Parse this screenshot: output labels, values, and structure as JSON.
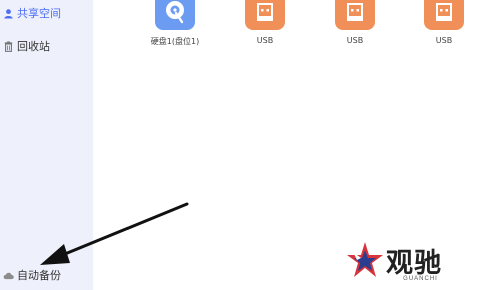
{
  "sidebar": {
    "items": [
      {
        "label": "共享空间",
        "icon": "user-share-icon",
        "active": true
      },
      {
        "label": "回收站",
        "icon": "trash-icon",
        "active": false
      },
      {
        "label": "自动备份",
        "icon": "cloud-icon",
        "active": false
      }
    ]
  },
  "drives": [
    {
      "label": "硬盘1(盘位1)",
      "icon": "hard-disk-icon",
      "color": "#6c9cf2"
    },
    {
      "label": "USB",
      "icon": "usb-drive-icon",
      "color": "#f18f59"
    },
    {
      "label": "USB",
      "icon": "usb-drive-icon",
      "color": "#f18f59"
    },
    {
      "label": "USB",
      "icon": "usb-drive-icon",
      "color": "#f18f59"
    }
  ],
  "watermark": {
    "text": "观驰",
    "sub": "GUANCHI"
  }
}
